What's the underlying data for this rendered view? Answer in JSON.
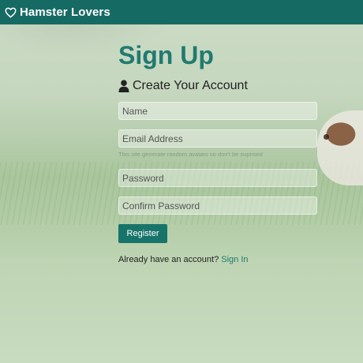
{
  "navbar": {
    "brand": "Hamster Lovers",
    "brand_icon": "heart-outline-icon",
    "color": "#166a64"
  },
  "form": {
    "title": "Sign Up",
    "lead_icon": "user-icon",
    "lead": "Create Your Account",
    "name_placeholder": "Name",
    "email_placeholder": "Email Address",
    "email_hint": "This site generate random avatars so don't be suprised",
    "password_placeholder": "Password",
    "confirm_placeholder": "Confirm Password",
    "submit_label": "Register",
    "signin_prompt": "Already have an account? ",
    "signin_link": "Sign In",
    "accent_color": "#217a70"
  }
}
